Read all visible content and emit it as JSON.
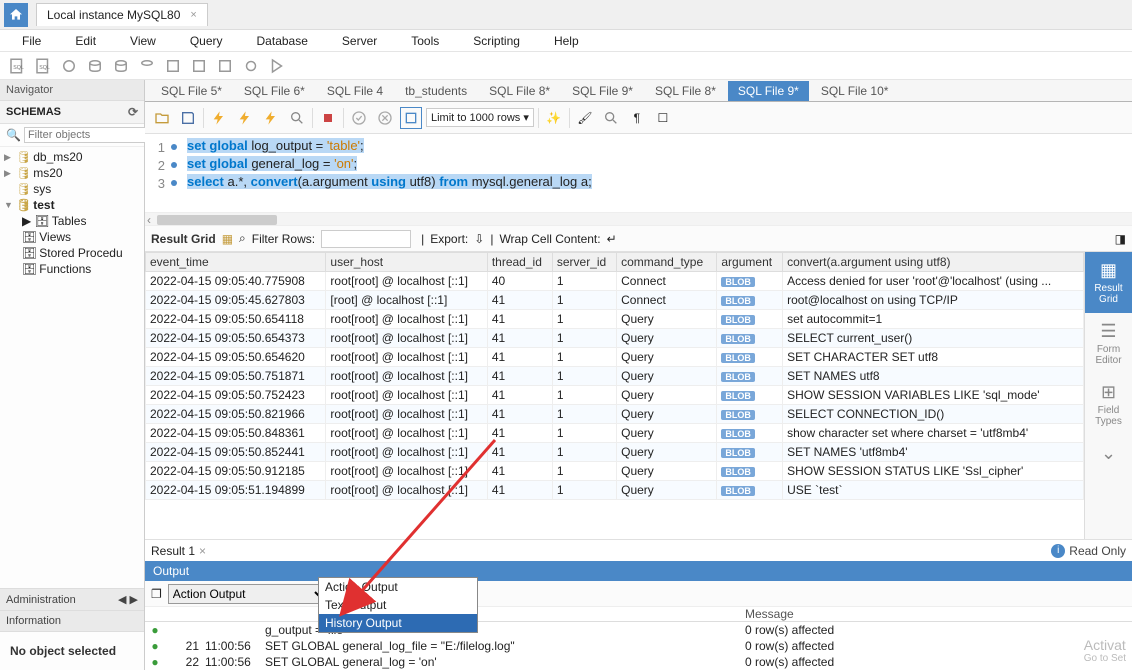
{
  "connection_tab": "Local instance MySQL80",
  "menu": [
    "File",
    "Edit",
    "View",
    "Query",
    "Database",
    "Server",
    "Tools",
    "Scripting",
    "Help"
  ],
  "nav": {
    "header": "Navigator",
    "schemas_label": "SCHEMAS",
    "filter_placeholder": "Filter objects",
    "items": [
      {
        "name": "db_ms20",
        "expanded": false,
        "bold": false
      },
      {
        "name": "ms20",
        "expanded": false,
        "bold": false
      },
      {
        "name": "sys",
        "expanded": false,
        "bold": false
      },
      {
        "name": "test",
        "expanded": true,
        "bold": true
      }
    ],
    "sub": [
      "Tables",
      "Views",
      "Stored Procedu",
      "Functions"
    ],
    "admin": "Administration",
    "info_label": "Information",
    "info_body": "No object selected"
  },
  "sql_tabs": [
    "SQL File 5*",
    "SQL File 6*",
    "SQL File 4",
    "tb_students",
    "SQL File 8*",
    "SQL File 9*",
    "SQL File 8*",
    "SQL File 9*",
    "SQL File 10*"
  ],
  "active_tab_index": 7,
  "limit_label": "Limit to 1000 rows",
  "code": {
    "l1a": "set",
    "l1b": "global",
    "l1c": "log_output = ",
    "l1d": "'table'",
    "l1e": ";",
    "l2a": "set",
    "l2b": "global",
    "l2c": "general_log = ",
    "l2d": "'on'",
    "l2e": ";",
    "l3a": "select",
    "l3b": " a.*, ",
    "l3c": "convert",
    "l3d": "(a.argument ",
    "l3e": "using",
    "l3f": " utf8) ",
    "l3g": "from",
    "l3h": " mysql.general_log a;"
  },
  "result_labels": {
    "grid": "Result Grid",
    "filter": "Filter Rows:",
    "export": "Export:",
    "wrap": "Wrap Cell Content:"
  },
  "columns": [
    "event_time",
    "user_host",
    "thread_id",
    "server_id",
    "command_type",
    "argument",
    "convert(a.argument using utf8)"
  ],
  "rows": [
    [
      "2022-04-15 09:05:40.775908",
      "root[root] @ localhost [::1]",
      "40",
      "1",
      "Connect",
      "BLOB",
      "Access denied for user 'root'@'localhost' (using ..."
    ],
    [
      "2022-04-15 09:05:45.627803",
      "[root] @ localhost [::1]",
      "41",
      "1",
      "Connect",
      "BLOB",
      "root@localhost on  using TCP/IP"
    ],
    [
      "2022-04-15 09:05:50.654118",
      "root[root] @ localhost [::1]",
      "41",
      "1",
      "Query",
      "BLOB",
      "set autocommit=1"
    ],
    [
      "2022-04-15 09:05:50.654373",
      "root[root] @ localhost [::1]",
      "41",
      "1",
      "Query",
      "BLOB",
      "SELECT current_user()"
    ],
    [
      "2022-04-15 09:05:50.654620",
      "root[root] @ localhost [::1]",
      "41",
      "1",
      "Query",
      "BLOB",
      "SET CHARACTER SET utf8"
    ],
    [
      "2022-04-15 09:05:50.751871",
      "root[root] @ localhost [::1]",
      "41",
      "1",
      "Query",
      "BLOB",
      "SET NAMES utf8"
    ],
    [
      "2022-04-15 09:05:50.752423",
      "root[root] @ localhost [::1]",
      "41",
      "1",
      "Query",
      "BLOB",
      "SHOW SESSION VARIABLES LIKE 'sql_mode'"
    ],
    [
      "2022-04-15 09:05:50.821966",
      "root[root] @ localhost [::1]",
      "41",
      "1",
      "Query",
      "BLOB",
      "SELECT CONNECTION_ID()"
    ],
    [
      "2022-04-15 09:05:50.848361",
      "root[root] @ localhost [::1]",
      "41",
      "1",
      "Query",
      "BLOB",
      "show character set where charset = 'utf8mb4'"
    ],
    [
      "2022-04-15 09:05:50.852441",
      "root[root] @ localhost [::1]",
      "41",
      "1",
      "Query",
      "BLOB",
      "SET NAMES 'utf8mb4'"
    ],
    [
      "2022-04-15 09:05:50.912185",
      "root[root] @ localhost [::1]",
      "41",
      "1",
      "Query",
      "BLOB",
      "SHOW SESSION STATUS LIKE 'Ssl_cipher'"
    ],
    [
      "2022-04-15 09:05:51.194899",
      "root[root] @ localhost [::1]",
      "41",
      "1",
      "Query",
      "BLOB",
      "USE `test`"
    ]
  ],
  "right_tools": [
    {
      "name": "Result Grid",
      "icon": "▦"
    },
    {
      "name": "Form Editor",
      "icon": "☰"
    },
    {
      "name": "Field Types",
      "icon": "⊞"
    }
  ],
  "result_tab": "Result 1",
  "read_only": "Read Only",
  "output": {
    "header": "Output",
    "selected": "Action Output",
    "options": [
      "Action Output",
      "Text Output",
      "History Output"
    ],
    "cols": {
      "msg": "Message"
    },
    "rows": [
      {
        "n": "",
        "time": "",
        "action": "g_output = 'file'",
        "msg": "0 row(s) affected"
      },
      {
        "n": "21",
        "time": "11:00:56",
        "action": "SET GLOBAL general_log_file = \"E:/filelog.log\"",
        "msg": "0 row(s) affected"
      },
      {
        "n": "22",
        "time": "11:00:56",
        "action": "SET GLOBAL general_log = 'on'",
        "msg": "0 row(s) affected"
      }
    ]
  },
  "watermark": {
    "l1": "Activat",
    "l2": "Go to Set"
  }
}
